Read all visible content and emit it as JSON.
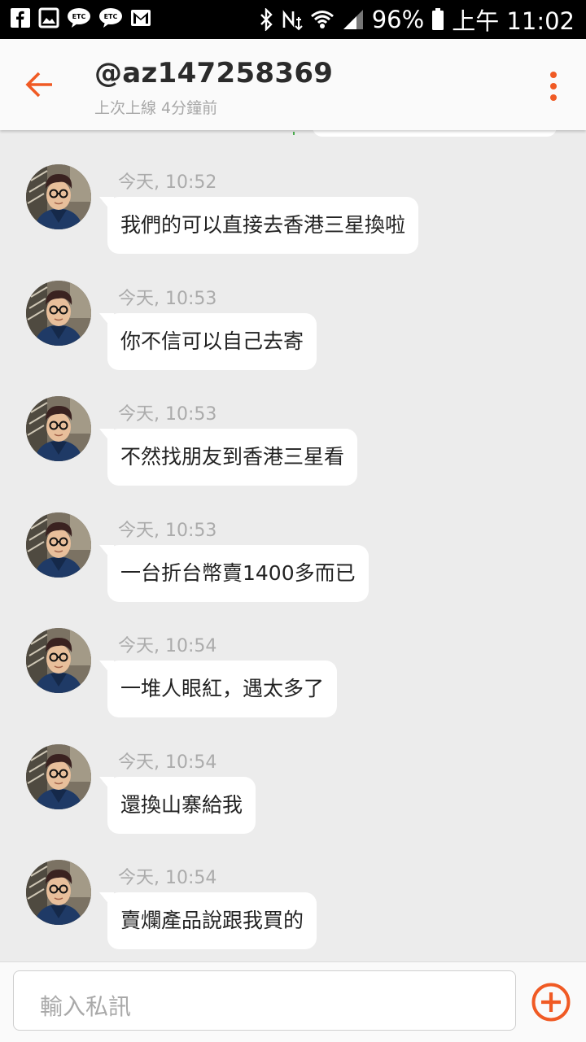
{
  "status_bar": {
    "battery": "96%",
    "time": "上午 11:02",
    "icons": [
      "facebook-icon",
      "gallery-icon",
      "etc-icon",
      "etc-icon",
      "gmail-icon",
      "bluetooth-icon",
      "nfc-icon",
      "wifi-icon",
      "signal-icon",
      "battery-icon"
    ]
  },
  "header": {
    "title": "@az147258369",
    "subtitle": "上次上線 4分鐘前",
    "accent_color": "#f05a24"
  },
  "messages": [
    {
      "time": "今天, 10:52",
      "text": "我們的可以直接去香港三星換啦"
    },
    {
      "time": "今天, 10:53",
      "text": "你不信可以自己去寄"
    },
    {
      "time": "今天, 10:53",
      "text": "不然找朋友到香港三星看"
    },
    {
      "time": "今天, 10:53",
      "text": "一台折台幣賣1400多而已"
    },
    {
      "time": "今天, 10:54",
      "text": "一堆人眼紅，遇太多了"
    },
    {
      "time": "今天, 10:54",
      "text": "還換山寨給我"
    },
    {
      "time": "今天, 10:54",
      "text": "賣爛產品說跟我買的"
    }
  ],
  "composer": {
    "placeholder": "輸入私訊"
  }
}
